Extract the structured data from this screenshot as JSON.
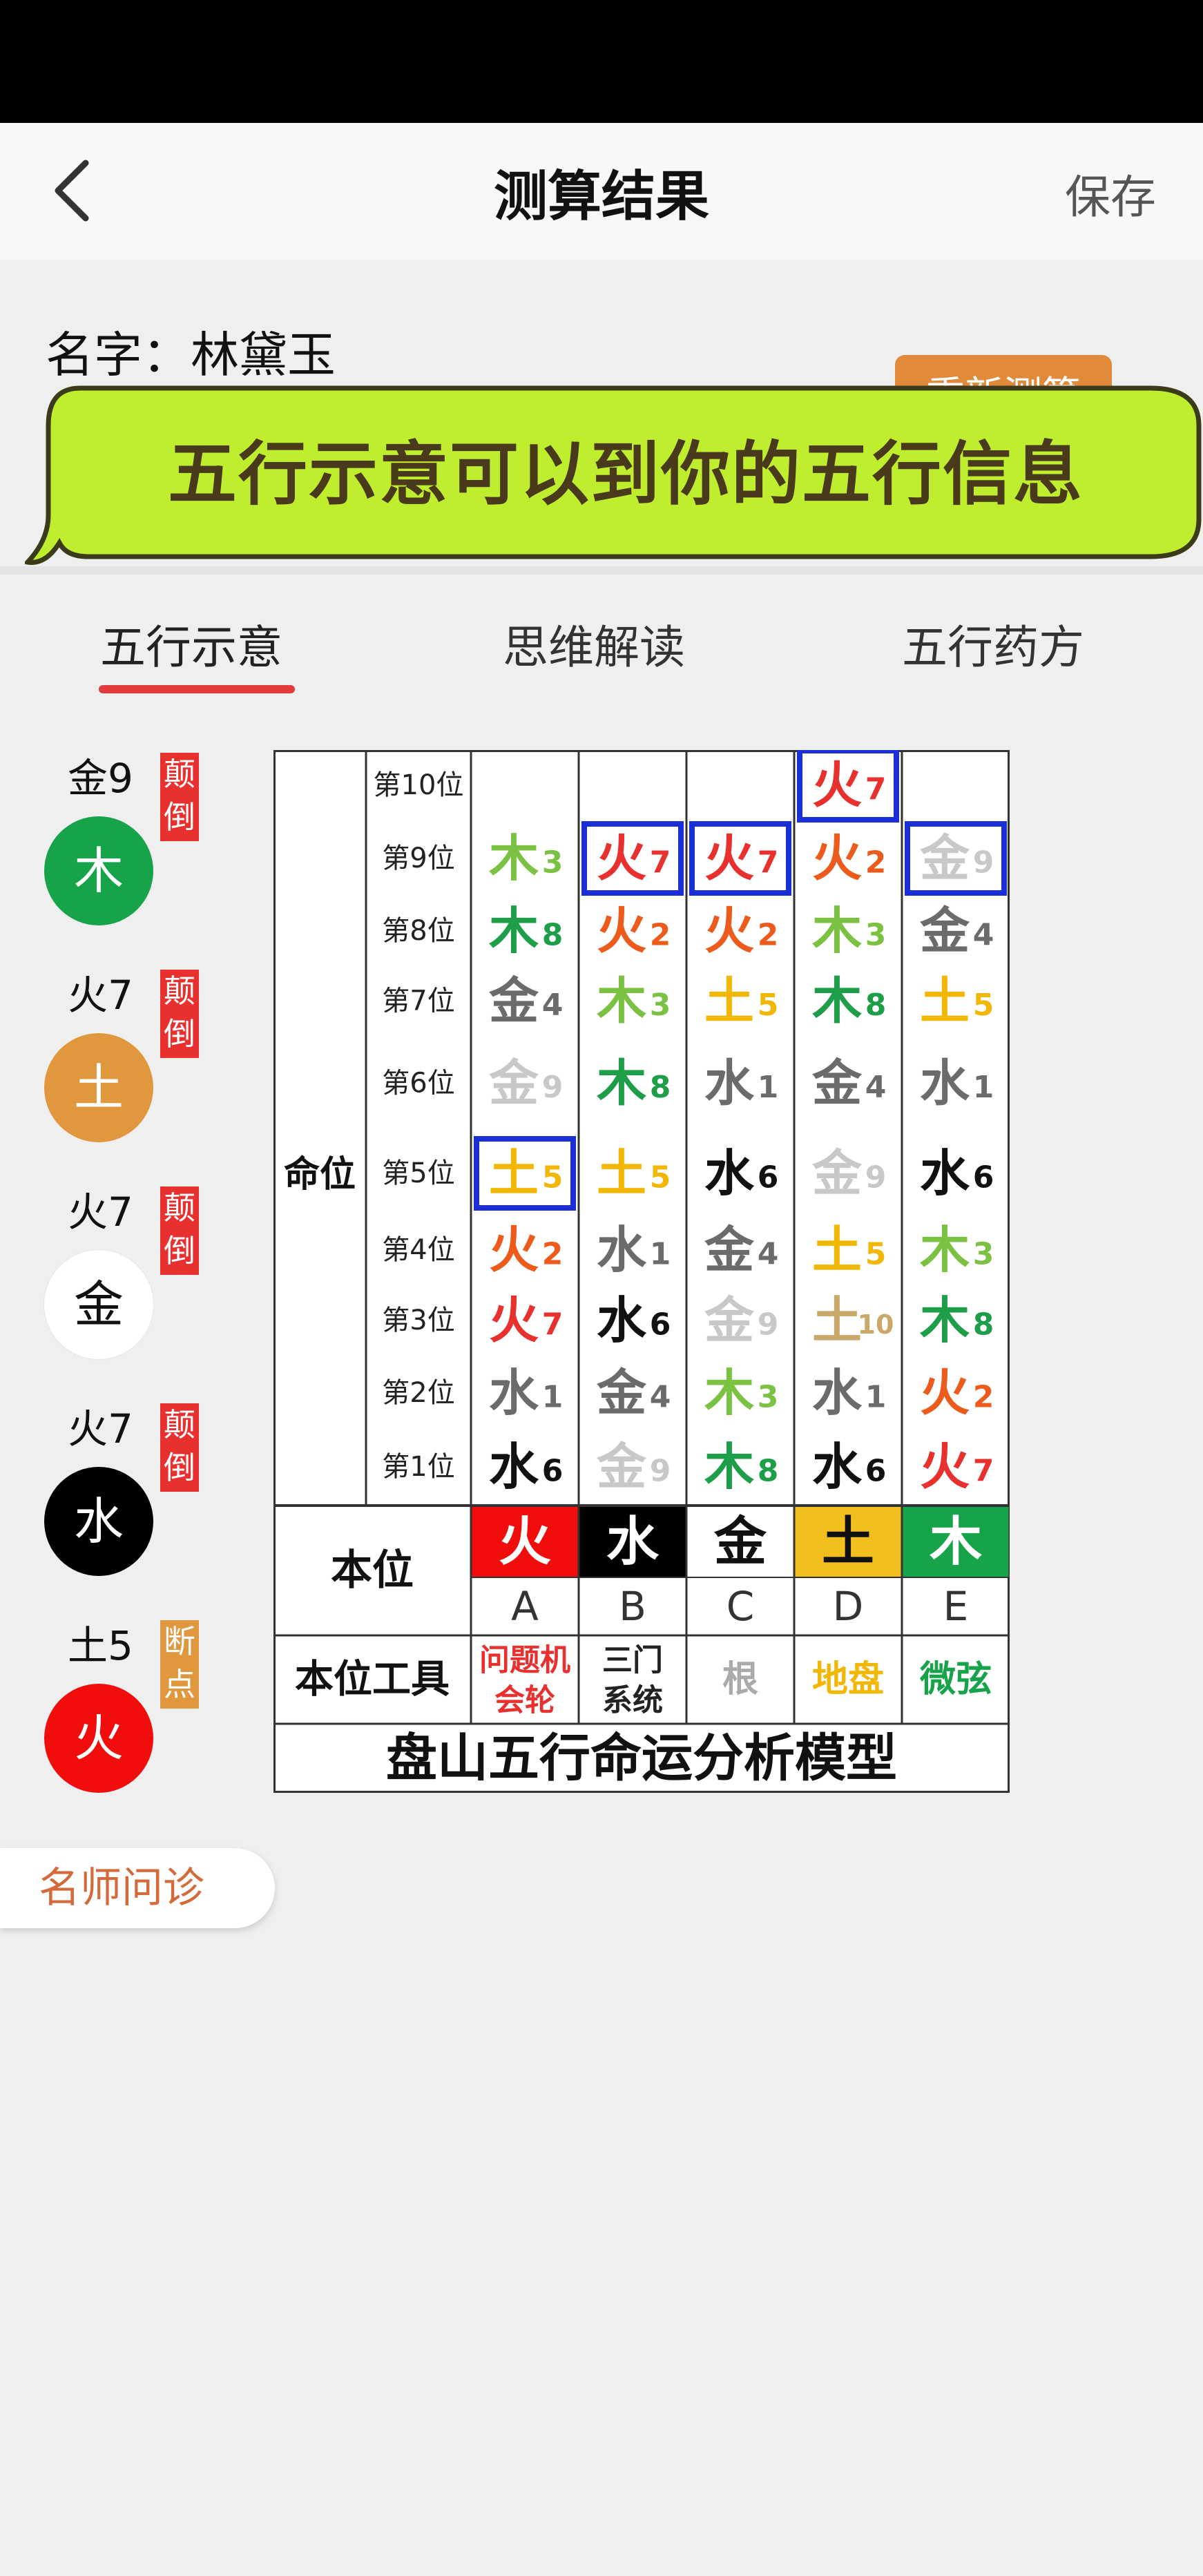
{
  "nav": {
    "title": "测算结果",
    "save_label": "保存"
  },
  "person": {
    "name_label": "名字：",
    "name": "林黛玉",
    "recalc_label": "重新测算"
  },
  "banner": {
    "text": "五行示意可以到你的五行信息"
  },
  "tabs": [
    {
      "label": "五行示意"
    },
    {
      "label": "思维解读"
    },
    {
      "label": "五行药方"
    }
  ],
  "elements": [
    {
      "value": "金9",
      "tag": "颠倒",
      "tag_color": "#e8312f",
      "name": "木",
      "bg": "#16a34a",
      "fg": "#ffffff"
    },
    {
      "value": "火7",
      "tag": "颠倒",
      "tag_color": "#e8312f",
      "name": "土",
      "bg": "#e0973e",
      "fg": "#ffffff"
    },
    {
      "value": "火7",
      "tag": "颠倒",
      "tag_color": "#e8312f",
      "name": "金",
      "bg": "#ffffff",
      "fg": "#111111"
    },
    {
      "value": "火7",
      "tag": "颠倒",
      "tag_color": "#e8312f",
      "name": "水",
      "bg": "#000000",
      "fg": "#ffffff"
    },
    {
      "value": "土5",
      "tag": "断点",
      "tag_color": "#e0973e",
      "name": "火",
      "bg": "#f20d0d",
      "fg": "#ffffff"
    }
  ],
  "consult_label": "名师问诊",
  "chart": {
    "fate_label": "命位",
    "position_labels": [
      "第10位",
      "第9位",
      "第8位",
      "第7位",
      "第6位",
      "第5位",
      "第4位",
      "第3位",
      "第2位",
      "第1位"
    ],
    "columns": [
      {
        "letter": "A",
        "element": "火",
        "bg": "#f20d0d",
        "fg": "#ffffff",
        "tool": [
          "问题机",
          "会轮"
        ],
        "tool_color": "#e8312f",
        "cells": [
          null,
          {
            "c": "木",
            "n": "3",
            "k": "lw"
          },
          {
            "c": "木",
            "n": "8",
            "k": "mu"
          },
          {
            "c": "金",
            "n": "4",
            "k": "jin"
          },
          {
            "c": "金",
            "n": "9",
            "k": "jl"
          },
          {
            "c": "土",
            "n": "5",
            "k": "tu",
            "box": true
          },
          {
            "c": "火",
            "n": "2",
            "k": "ho"
          },
          {
            "c": "火",
            "n": "7",
            "k": "hr"
          },
          {
            "c": "水",
            "n": "1",
            "k": "sg"
          },
          {
            "c": "水",
            "n": "6",
            "k": "sb"
          }
        ]
      },
      {
        "letter": "B",
        "element": "水",
        "bg": "#000000",
        "fg": "#ffffff",
        "tool": [
          "三门",
          "系统"
        ],
        "tool_color": "#222222",
        "cells": [
          null,
          {
            "c": "火",
            "n": "7",
            "k": "hr",
            "box": true
          },
          {
            "c": "火",
            "n": "2",
            "k": "ho"
          },
          {
            "c": "木",
            "n": "3",
            "k": "lw"
          },
          {
            "c": "木",
            "n": "8",
            "k": "mu"
          },
          {
            "c": "土",
            "n": "5",
            "k": "tu"
          },
          {
            "c": "水",
            "n": "1",
            "k": "sg"
          },
          {
            "c": "水",
            "n": "6",
            "k": "sb"
          },
          {
            "c": "金",
            "n": "4",
            "k": "jin"
          },
          {
            "c": "金",
            "n": "9",
            "k": "jl"
          }
        ]
      },
      {
        "letter": "C",
        "element": "金",
        "bg": "#ffffff",
        "fg": "#111111",
        "tool": [
          "根"
        ],
        "tool_color": "#aaaaaa",
        "cells": [
          null,
          {
            "c": "火",
            "n": "7",
            "k": "hr",
            "box": true
          },
          {
            "c": "火",
            "n": "2",
            "k": "ho"
          },
          {
            "c": "土",
            "n": "5",
            "k": "tu"
          },
          {
            "c": "水",
            "n": "1",
            "k": "sg"
          },
          {
            "c": "水",
            "n": "6",
            "k": "sb"
          },
          {
            "c": "金",
            "n": "4",
            "k": "jin"
          },
          {
            "c": "金",
            "n": "9",
            "k": "jl"
          },
          {
            "c": "木",
            "n": "3",
            "k": "lw"
          },
          {
            "c": "木",
            "n": "8",
            "k": "mu"
          }
        ]
      },
      {
        "letter": "D",
        "element": "土",
        "bg": "#f2bf1e",
        "fg": "#111111",
        "tool": [
          "地盘"
        ],
        "tool_color": "#f2b705",
        "cells": [
          {
            "c": "火",
            "n": "7",
            "k": "hr",
            "box": true
          },
          {
            "c": "火",
            "n": "2",
            "k": "ho"
          },
          {
            "c": "木",
            "n": "3",
            "k": "lw"
          },
          {
            "c": "木",
            "n": "8",
            "k": "mu"
          },
          {
            "c": "金",
            "n": "4",
            "k": "jin"
          },
          {
            "c": "金",
            "n": "9",
            "k": "jl"
          },
          {
            "c": "土",
            "n": "5",
            "k": "tu"
          },
          {
            "c": "土",
            "n": "10",
            "k": "tb"
          },
          {
            "c": "水",
            "n": "1",
            "k": "sg"
          },
          {
            "c": "水",
            "n": "6",
            "k": "sb"
          }
        ]
      },
      {
        "letter": "E",
        "element": "木",
        "bg": "#16a34a",
        "fg": "#ffffff",
        "tool": [
          "微弦"
        ],
        "tool_color": "#16a34a",
        "cells": [
          null,
          {
            "c": "金",
            "n": "9",
            "k": "jl",
            "box": true
          },
          {
            "c": "金",
            "n": "4",
            "k": "jin"
          },
          {
            "c": "土",
            "n": "5",
            "k": "tu"
          },
          {
            "c": "水",
            "n": "1",
            "k": "sg"
          },
          {
            "c": "水",
            "n": "6",
            "k": "sb"
          },
          {
            "c": "木",
            "n": "3",
            "k": "lw"
          },
          {
            "c": "木",
            "n": "8",
            "k": "mu"
          },
          {
            "c": "火",
            "n": "2",
            "k": "ho"
          },
          {
            "c": "火",
            "n": "7",
            "k": "hr"
          }
        ]
      }
    ],
    "base_label": "本位",
    "tool_label": "本位工具",
    "footer": "盘山五行命运分析模型",
    "colors": {
      "lw": "#7cc242",
      "mu": "#1e9e48",
      "jin": "#6b6b6b",
      "jl": "#c8c8c8",
      "tu": "#f2b705",
      "tb": "#c9a86a",
      "ho": "#ec5a1c",
      "hr": "#e8312f",
      "sg": "#6b6b6b",
      "sb": "#111111"
    },
    "box_color": "#1b2fd6"
  }
}
